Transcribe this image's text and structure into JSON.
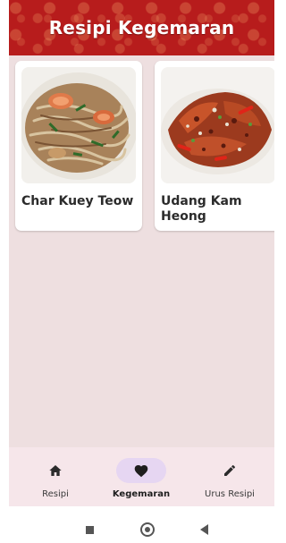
{
  "app": {
    "title": "Resipi Kegemaran",
    "theme_color": "#b71c1c"
  },
  "favorites": [
    {
      "name": "Char Kuey Teow",
      "image": "char-kuey-teow-photo"
    },
    {
      "name": "Udang Kam Heong",
      "image": "udang-kam-heong-photo"
    }
  ],
  "bottom_nav": {
    "items": [
      {
        "label": "Resipi",
        "icon": "home-icon",
        "active": false
      },
      {
        "label": "Kegemaran",
        "icon": "heart-icon",
        "active": true
      },
      {
        "label": "Urus Resipi",
        "icon": "pencil-icon",
        "active": false
      }
    ]
  },
  "system_nav": {
    "icons": [
      "recents-square-icon",
      "home-circle-icon",
      "back-triangle-icon"
    ]
  }
}
